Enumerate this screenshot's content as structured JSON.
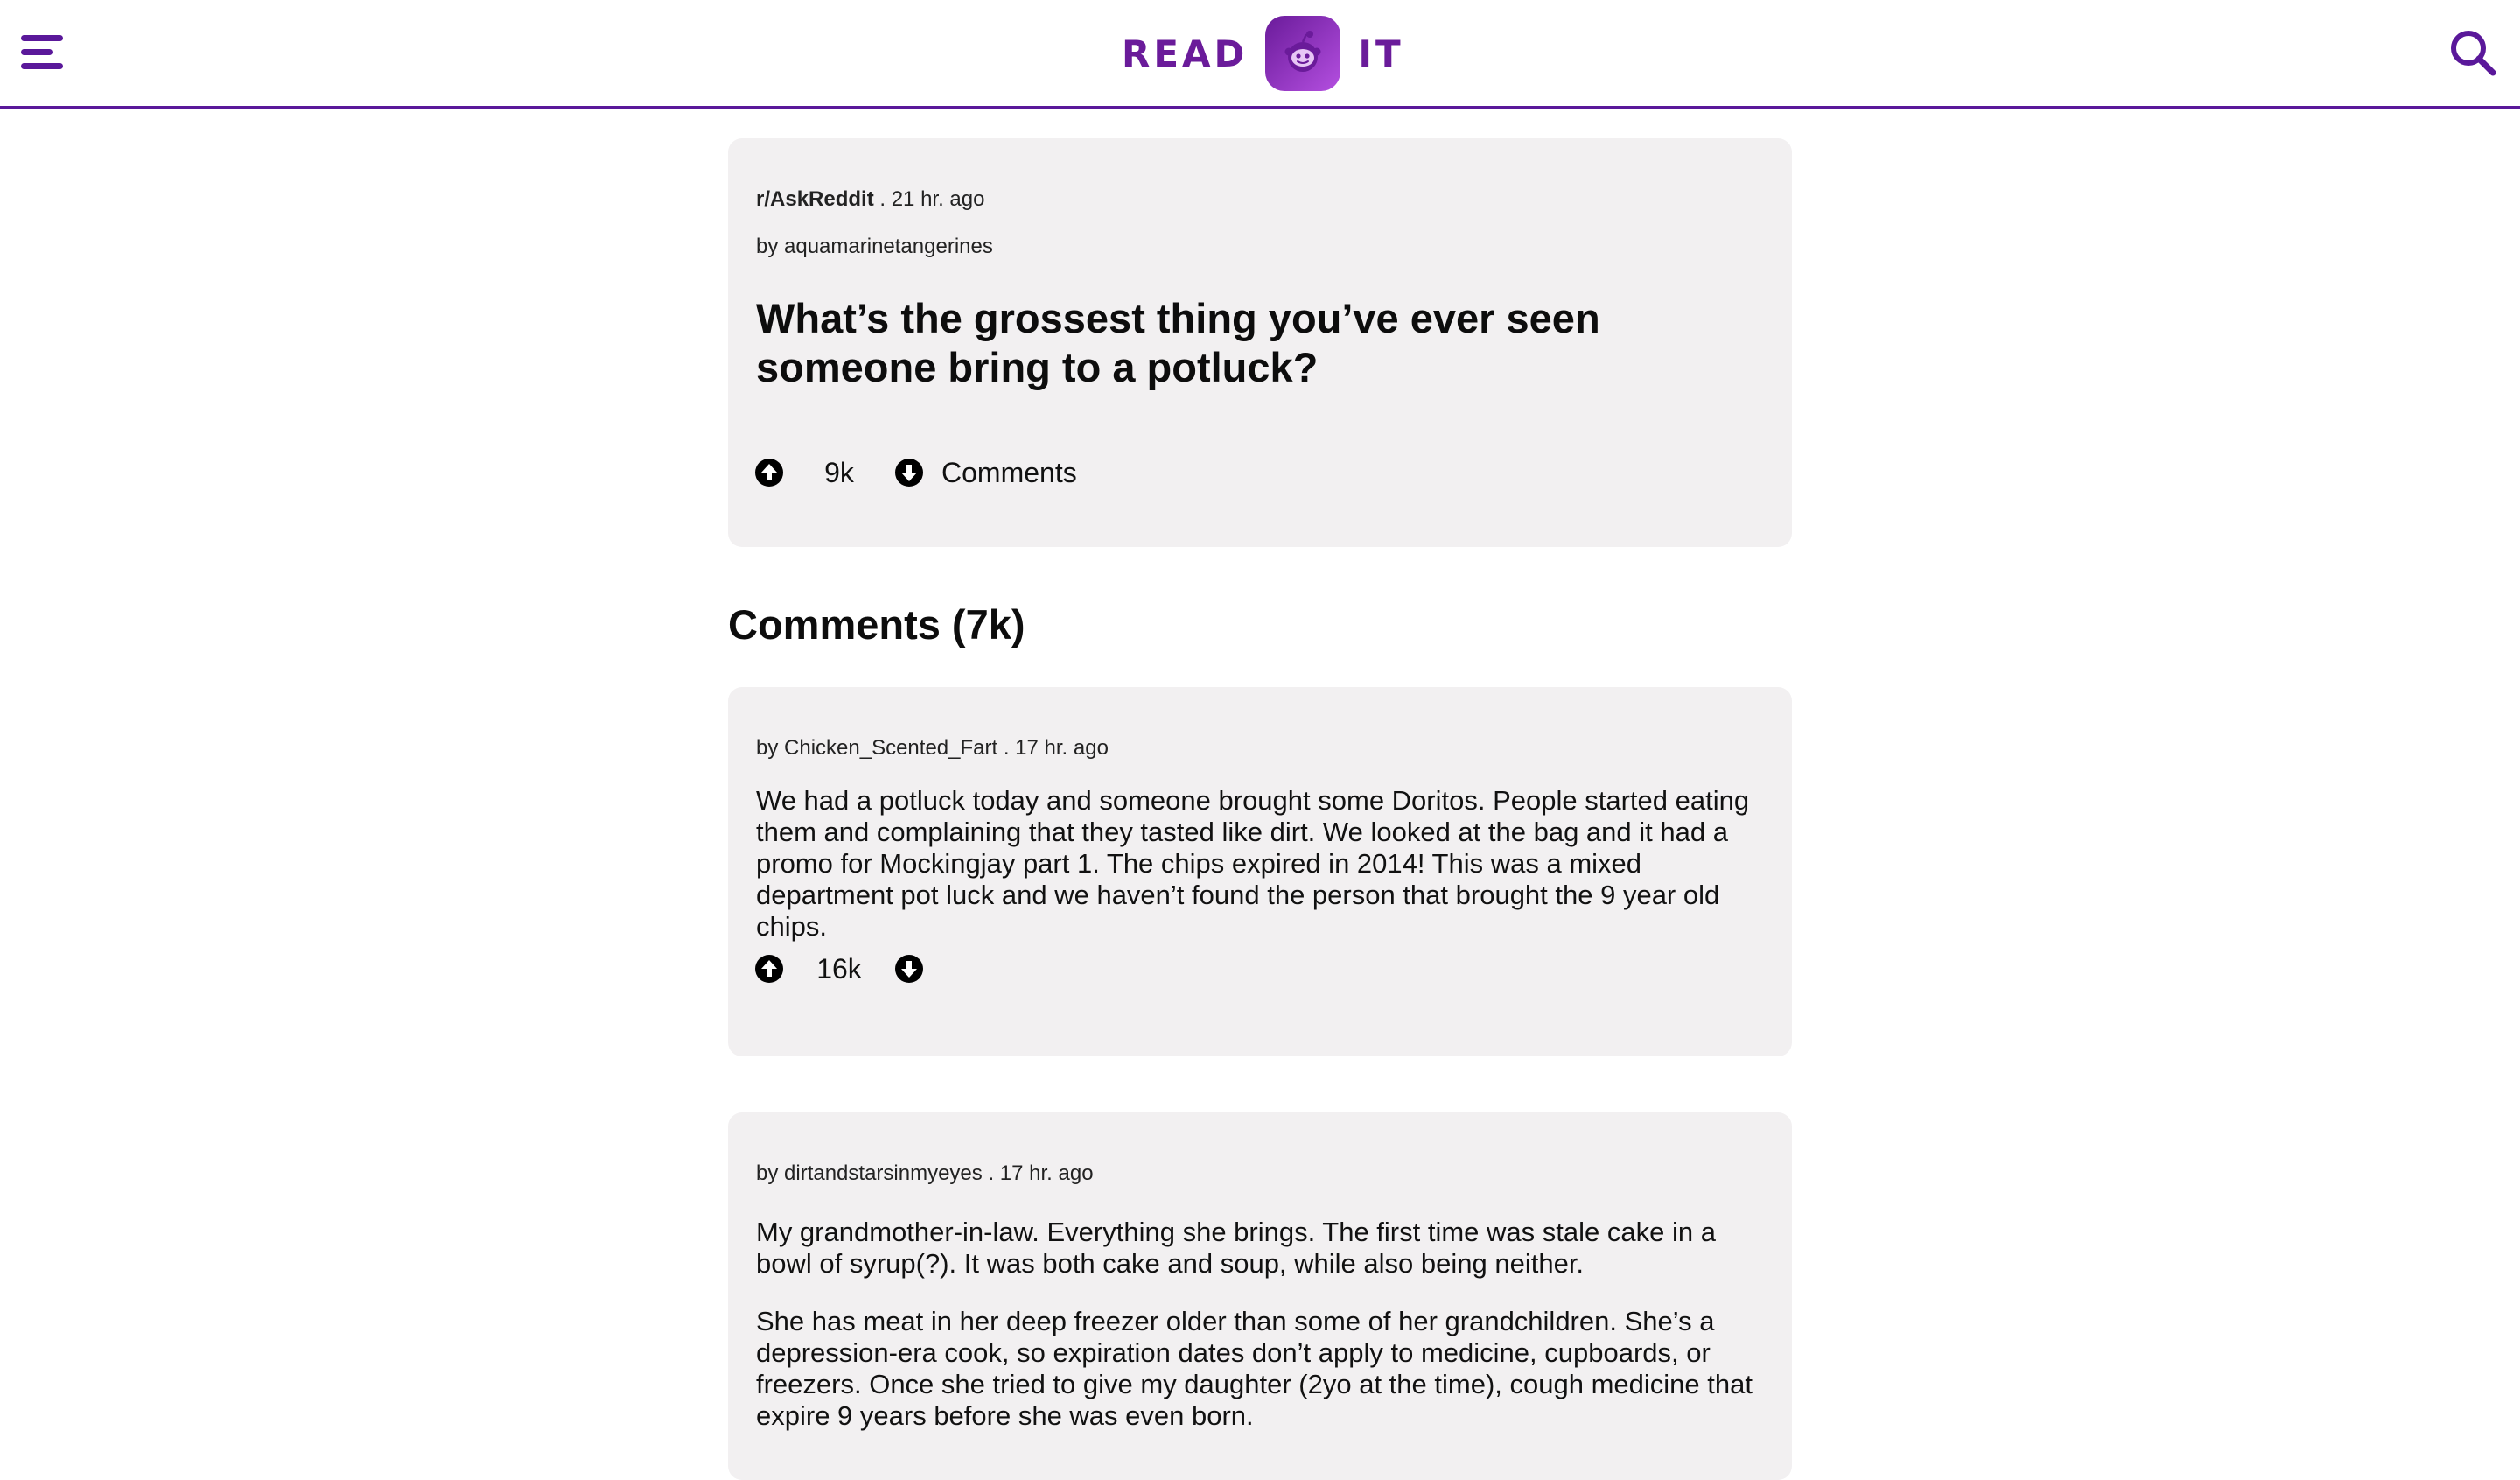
{
  "header": {
    "logo_left": "READ",
    "logo_right": "IT",
    "menu_icon": "hamburger-menu-icon",
    "search_icon": "search-icon",
    "accent_color": "#5a189a"
  },
  "post": {
    "subreddit": "r/AskReddit",
    "time": ". 21 hr. ago",
    "author": "by aquamarinetangerines",
    "title": "What’s the grossest thing you’ve ever seen someone bring to a potluck?",
    "votes": "9k",
    "comments_label": "Comments"
  },
  "comments_heading": "Comments (7k)",
  "comments": [
    {
      "author": "by Chicken_Scented_Fart",
      "time": ". 17 hr. ago",
      "body": "We had a potluck today and someone brought some Doritos. People started eating them and complaining that they tasted like dirt. We looked at the bag and it had a promo for Mockingjay part 1. The chips expired in 2014! This was a mixed department pot luck and we haven’t found the person that brought the 9 year old chips.",
      "votes": "16k"
    },
    {
      "author": "by dirtandstarsinmyeyes",
      "time": ". 17 hr. ago",
      "body_p1": "My grandmother-in-law. Everything she brings. The first time was stale cake in a bowl of syrup(?). It was both cake and soup, while also being neither.",
      "body_p2": "She has meat in her deep freezer older than some of her grandchildren. She’s a depression-era cook, so expiration dates don’t apply to medicine, cupboards, or freezers. Once she tried to give my daughter (2yo at the time), cough medicine that expire 9 years before she was even born."
    }
  ]
}
